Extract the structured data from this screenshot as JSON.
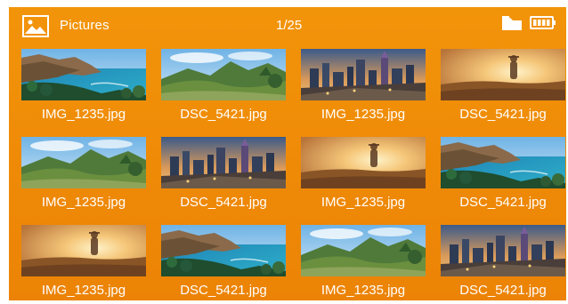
{
  "header": {
    "title": "Pictures",
    "counter": "1/25",
    "app_icon": "pictures-icon",
    "storage_icon": "sd-card-folder-icon",
    "battery_icon": "battery-icon"
  },
  "colors": {
    "background": "#f0900a",
    "text": "#ffffff"
  },
  "grid": {
    "columns": 4,
    "items": [
      {
        "filename": "IMG_1235.jpg",
        "scene": "coast"
      },
      {
        "filename": "DSC_5421.jpg",
        "scene": "valley"
      },
      {
        "filename": "IMG_1235.jpg",
        "scene": "city"
      },
      {
        "filename": "DSC_5421.jpg",
        "scene": "sunset"
      },
      {
        "filename": "IMG_1235.jpg",
        "scene": "valley"
      },
      {
        "filename": "DSC_5421.jpg",
        "scene": "city"
      },
      {
        "filename": "IMG_1235.jpg",
        "scene": "sunset"
      },
      {
        "filename": "DSC_5421.jpg",
        "scene": "coast"
      },
      {
        "filename": "IMG_1235.jpg",
        "scene": "sunset"
      },
      {
        "filename": "DSC_5421.jpg",
        "scene": "coast"
      },
      {
        "filename": "IMG_1235.jpg",
        "scene": "valley"
      },
      {
        "filename": "DSC_5421.jpg",
        "scene": "city"
      }
    ]
  }
}
